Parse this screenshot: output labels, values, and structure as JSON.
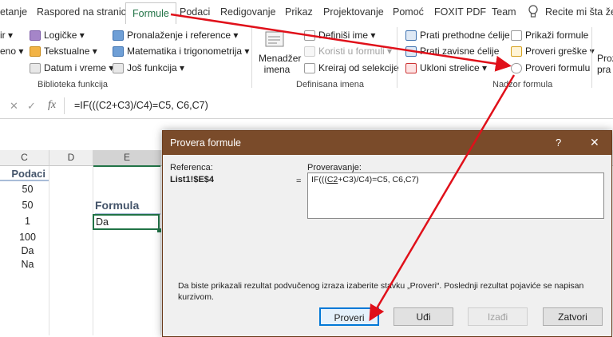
{
  "tabs": [
    {
      "label": "etanje"
    },
    {
      "label": "Raspored na stranici"
    },
    {
      "label": "Formule"
    },
    {
      "label": "Podaci"
    },
    {
      "label": "Redigovanje"
    },
    {
      "label": "Prikaz"
    },
    {
      "label": "Projektovanje"
    },
    {
      "label": "Pomoć"
    },
    {
      "label": "FOXIT PDF"
    },
    {
      "label": "Team"
    }
  ],
  "tell_me": "Recite mi šta želi",
  "ribbon": {
    "library": {
      "left_col": [
        "ir ▾",
        "eno ▾"
      ],
      "col1": [
        "Logičke ▾",
        "Tekstualne ▾",
        "Datum i vreme ▾"
      ],
      "col2": [
        "Pronalaženje i reference ▾",
        "Matematika i trigonometrija ▾",
        "Još funkcija ▾"
      ],
      "group_label": "Biblioteka funkcija"
    },
    "names": {
      "manager_line1": "Menadžer",
      "manager_line2": "imena",
      "items": [
        "Definiši ime ▾",
        "Koristi u formuli ▾",
        "Kreiraj od selekcije"
      ],
      "group_label": "Definisana imena"
    },
    "audit": {
      "col1": [
        "Prati prethodne ćelije",
        "Prati zavisne ćelije",
        "Ukloni strelice ▾"
      ],
      "col2": [
        "Prikaži formule",
        "Proveri greške ▾",
        "Proveri formulu"
      ],
      "group_label": "Nadzor formula"
    },
    "right_cut": [
      "Proz",
      "pra"
    ]
  },
  "formula_bar": {
    "cancel": "✕",
    "enter": "✓",
    "fx": "fx",
    "text": "=IF(((C2+C3)/C4)=C5, C6,C7)"
  },
  "grid": {
    "col_headers": [
      "C",
      "D",
      "E"
    ],
    "col_c": [
      "Podaci",
      "50",
      "50",
      "1",
      "100",
      "Da",
      "Na"
    ],
    "e_title": "Formula",
    "e_value": "Da"
  },
  "dialog": {
    "title": "Provera formule",
    "help": "?",
    "close": "✕",
    "ref_label": "Referenca:",
    "ref_value": "List1!$E$4",
    "eval_label": "Proveravanje:",
    "equals": "=",
    "eval_pre": "IF(((",
    "eval_under": "C2",
    "eval_post": "+C3)/C4)=C5, C6,C7)",
    "hint": "Da biste prikazali rezultat podvučenog izraza izaberite stavku „Proveri“. Poslednji rezultat pojaviće se napisan kurzivom.",
    "buttons": [
      "Proveri",
      "Uđi",
      "Izađi",
      "Zatvori"
    ]
  },
  "colors": {
    "accent_green": "#217346",
    "arrow_red": "#e0101a",
    "dialog_title_bg": "#7a4b2a"
  }
}
